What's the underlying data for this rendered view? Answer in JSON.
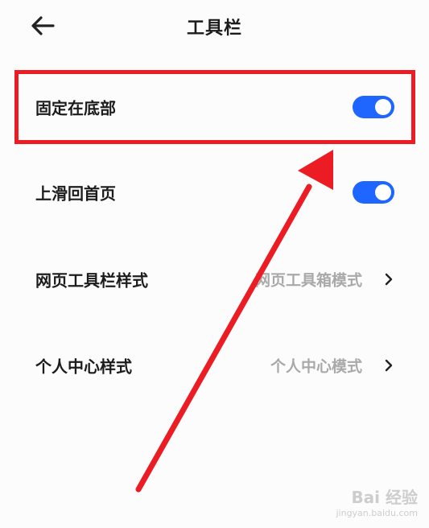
{
  "header": {
    "title": "工具栏",
    "back_icon": "arrow-left-icon"
  },
  "settings": {
    "pin_bottom": {
      "label": "固定在底部",
      "enabled": true
    },
    "swipe_home": {
      "label": "上滑回首页",
      "enabled": true
    },
    "web_toolbar_style": {
      "label": "网页工具栏样式",
      "value": "网页工具箱模式"
    },
    "personal_center_style": {
      "label": "个人中心样式",
      "value": "个人中心模式"
    }
  },
  "colors": {
    "toggle_on": "#1e66ff",
    "annotation_red": "#ec1c24",
    "secondary_text": "#a9a9a9"
  },
  "watermark": {
    "main": "Bai 经验",
    "sub": "jingyan.baidu.com"
  }
}
